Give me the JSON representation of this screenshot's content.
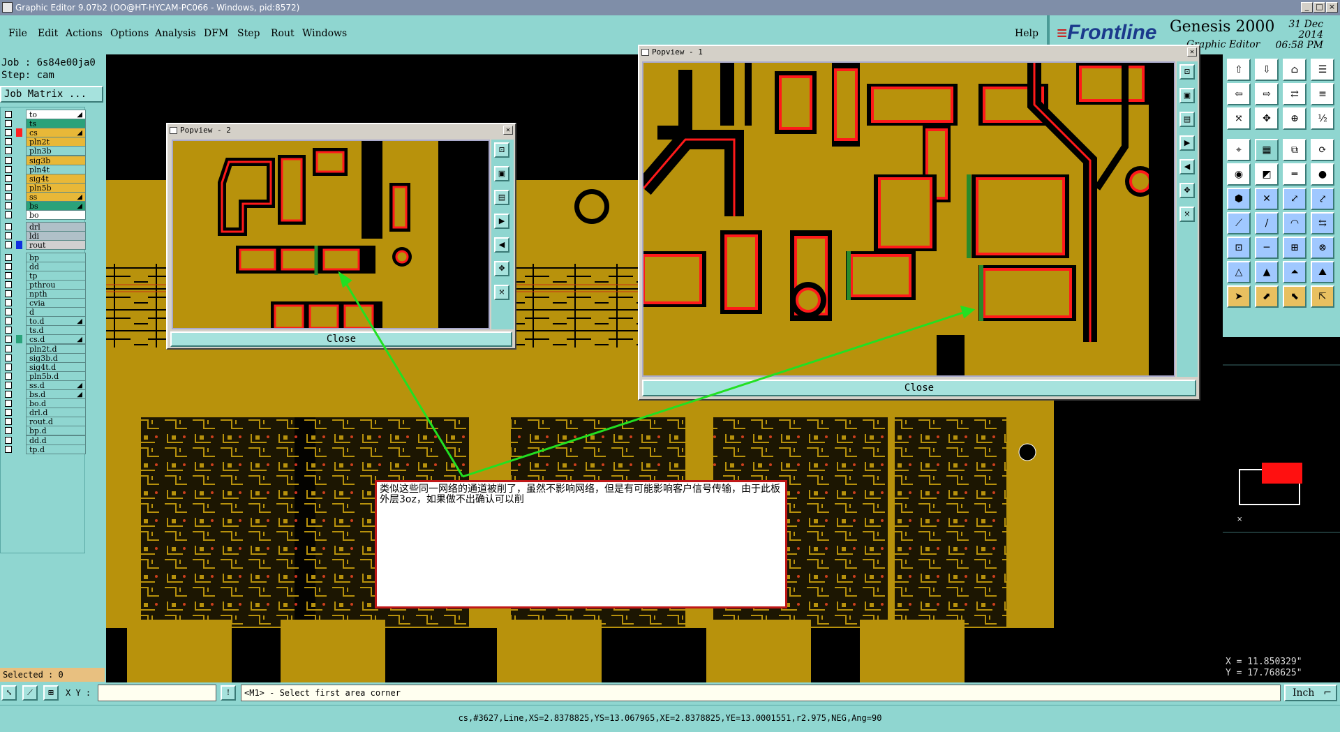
{
  "window": {
    "title": "Graphic Editor 9.07b2 (OO@HT-HYCAM-PC066 - Windows, pid:8572)",
    "minimize": "_",
    "maximize": "□",
    "close": "×"
  },
  "menu": {
    "items": [
      "File",
      "Edit",
      "Actions",
      "Options",
      "Analysis",
      "DFM",
      "Step",
      "Rout",
      "Windows"
    ],
    "help": "Help"
  },
  "brand": {
    "logo_prefix": "Front",
    "logo_suffix": "line",
    "product": "Genesis 2000",
    "subtitle": "Graphic Editor",
    "date": "31 Dec 2014",
    "time": "06:58 PM"
  },
  "job": {
    "job_label": "Job : 6s84e00ja0",
    "step_label": "Step: cam",
    "matrix_button": "Job Matrix ..."
  },
  "layers": [
    {
      "name": "to",
      "color": "#ffffff",
      "swatch": "",
      "mark": "◢"
    },
    {
      "name": "ts",
      "color": "#2aa27a",
      "swatch": "",
      "mark": ""
    },
    {
      "name": "cs",
      "color": "#e8b838",
      "swatch": "#ff2020",
      "mark": "◢"
    },
    {
      "name": "pln2t",
      "color": "#e8b838",
      "swatch": "",
      "mark": ""
    },
    {
      "name": "pln3b",
      "color": "#8fd6d0",
      "swatch": "",
      "mark": ""
    },
    {
      "name": "sig3b",
      "color": "#e8b838",
      "swatch": "",
      "mark": ""
    },
    {
      "name": "pln4t",
      "color": "#8fd6d0",
      "swatch": "",
      "mark": ""
    },
    {
      "name": "sig4t",
      "color": "#e8b838",
      "swatch": "",
      "mark": ""
    },
    {
      "name": "pln5b",
      "color": "#e8b838",
      "swatch": "",
      "mark": ""
    },
    {
      "name": "ss",
      "color": "#e8b838",
      "swatch": "",
      "mark": "◢"
    },
    {
      "name": "bs",
      "color": "#2aa27a",
      "swatch": "",
      "mark": "◢"
    },
    {
      "name": "bo",
      "color": "#ffffff",
      "swatch": "",
      "mark": ""
    },
    {
      "name": "drl",
      "color": "#b0c0c8",
      "swatch": "",
      "mark": ""
    },
    {
      "name": "ldi",
      "color": "#b0c0c8",
      "swatch": "",
      "mark": ""
    },
    {
      "name": "rout",
      "color": "#d0d0d0",
      "swatch": "#1030e0",
      "mark": ""
    },
    {
      "name": "bp",
      "color": "#8fd6d0",
      "swatch": "",
      "mark": ""
    },
    {
      "name": "dd",
      "color": "#8fd6d0",
      "swatch": "",
      "mark": ""
    },
    {
      "name": "tp",
      "color": "#8fd6d0",
      "swatch": "",
      "mark": ""
    },
    {
      "name": "pthrou",
      "color": "#8fd6d0",
      "swatch": "",
      "mark": ""
    },
    {
      "name": "npth",
      "color": "#8fd6d0",
      "swatch": "",
      "mark": ""
    },
    {
      "name": "cvia",
      "color": "#8fd6d0",
      "swatch": "",
      "mark": ""
    },
    {
      "name": "d",
      "color": "#8fd6d0",
      "swatch": "",
      "mark": ""
    },
    {
      "name": "to.d",
      "color": "#8fd6d0",
      "swatch": "",
      "mark": "◢"
    },
    {
      "name": "ts.d",
      "color": "#8fd6d0",
      "swatch": "",
      "mark": ""
    },
    {
      "name": "cs.d",
      "color": "#8fd6d0",
      "swatch": "#2aa27a",
      "mark": "◢"
    },
    {
      "name": "pln2t.d",
      "color": "#8fd6d0",
      "swatch": "",
      "mark": ""
    },
    {
      "name": "sig3b.d",
      "color": "#8fd6d0",
      "swatch": "",
      "mark": ""
    },
    {
      "name": "sig4t.d",
      "color": "#8fd6d0",
      "swatch": "",
      "mark": ""
    },
    {
      "name": "pln5b.d",
      "color": "#8fd6d0",
      "swatch": "",
      "mark": ""
    },
    {
      "name": "ss.d",
      "color": "#8fd6d0",
      "swatch": "",
      "mark": "◢"
    },
    {
      "name": "bs.d",
      "color": "#8fd6d0",
      "swatch": "",
      "mark": "◢"
    },
    {
      "name": "bo.d",
      "color": "#8fd6d0",
      "swatch": "",
      "mark": ""
    },
    {
      "name": "drl.d",
      "color": "#8fd6d0",
      "swatch": "",
      "mark": ""
    },
    {
      "name": "rout.d",
      "color": "#8fd6d0",
      "swatch": "",
      "mark": ""
    },
    {
      "name": "bp.d",
      "color": "#8fd6d0",
      "swatch": "",
      "mark": ""
    },
    {
      "name": "dd.d",
      "color": "#8fd6d0",
      "swatch": "",
      "mark": ""
    },
    {
      "name": "tp.d",
      "color": "#8fd6d0",
      "swatch": "",
      "mark": ""
    }
  ],
  "popups": {
    "popview2": {
      "title": "Popview - 2",
      "close_label": "Close"
    },
    "popview1": {
      "title": "Popview - 1",
      "close_label": "Close"
    }
  },
  "annotation": {
    "text": "类似这些同一网络的通道被削了，虽然不影响网络，但是有可能影响客户信号传输，由于此板外层3oz，如果做不出确认可以削"
  },
  "status": {
    "selected": "Selected : 0",
    "xy_label": "X Y :",
    "xy_value": "",
    "message": "<M1> - Select first area corner",
    "unit": "Inch",
    "info": "cs,#3627,Line,XS=2.8378825,YS=13.067965,XE=2.8378825,YE=13.0001551,r2.975,NEG,Ang=90",
    "x_coord": "X = 11.850329\"",
    "y_coord": "Y = 17.768625\""
  },
  "colors": {
    "panel": "#8fd6d0",
    "copper": "#b8920c",
    "highlight_red": "#ff1a1a",
    "trace_green": "#2a8a2a",
    "arrow_green": "#22e022"
  },
  "icons": {
    "right_toolbar": [
      "open-icon",
      "save-icon",
      "home-icon",
      "list-icon",
      "copy-icon",
      "paste-icon",
      "swap-icon",
      "menu-icon",
      "fit-icon",
      "pan-icon",
      "zoom-icon",
      "ratio-icon",
      "snap-icon",
      "grid-icon",
      "layers-icon",
      "sync-icon",
      "select-icon",
      "feature-icon",
      "measure-icon",
      "pad-icon",
      "net-icon",
      "cross-icon",
      "link-icon",
      "arrow-icon",
      "line-icon",
      "slash-icon",
      "arc-icon",
      "flip-icon",
      "node-icon",
      "minus-icon",
      "target-icon",
      "connect-icon",
      "triangle-icon",
      "polygon-icon",
      "shape-icon",
      "mountain-icon",
      "pointer-icon",
      "pointer2-icon",
      "pointer3-icon",
      "pointer4-icon"
    ]
  }
}
